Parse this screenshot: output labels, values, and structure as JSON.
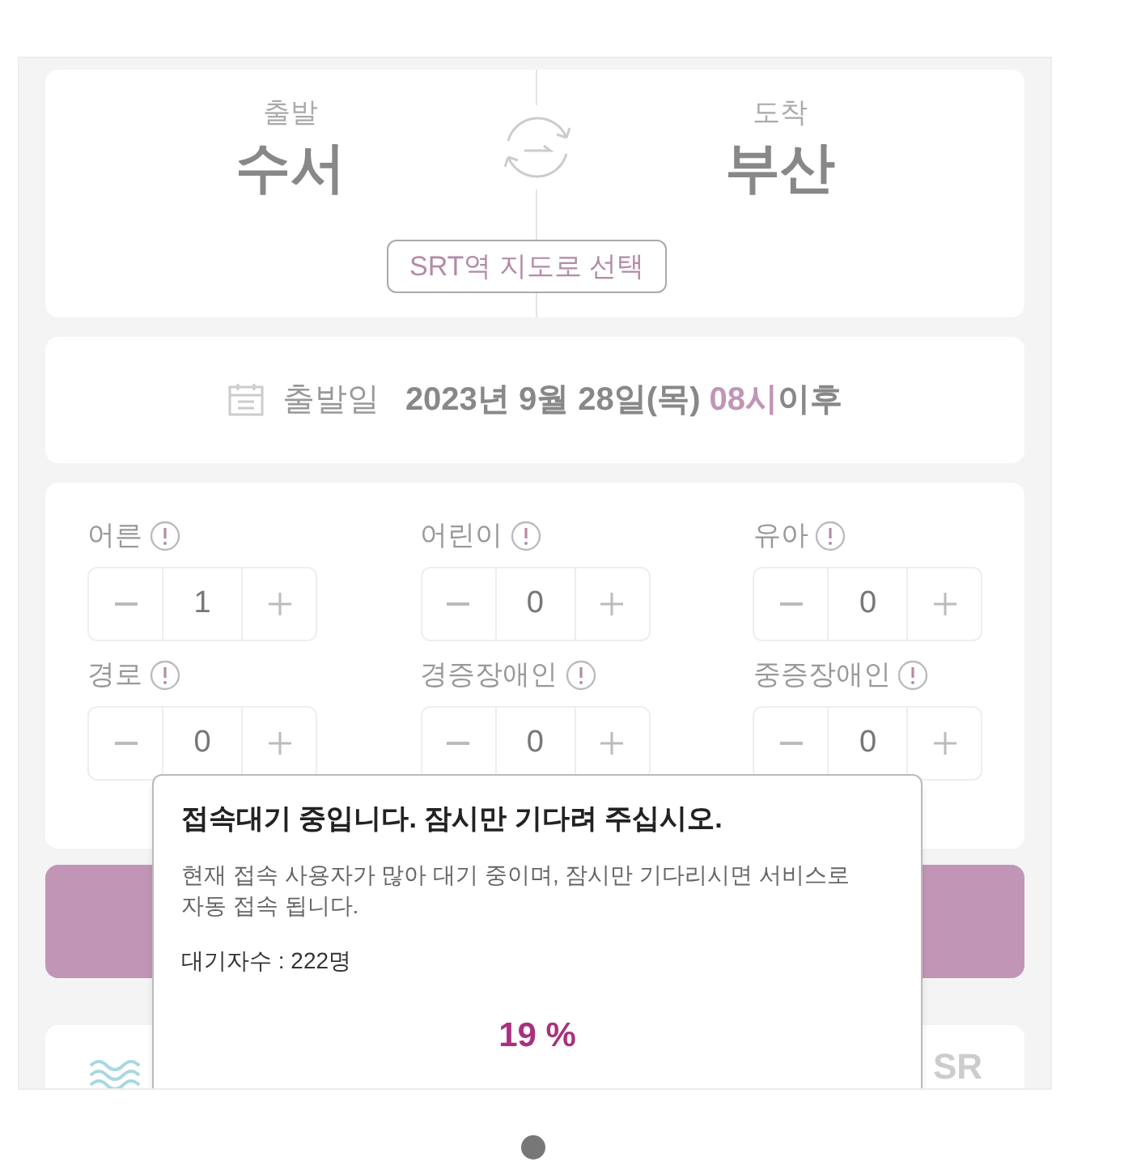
{
  "route": {
    "departure_label": "출발",
    "departure": "수서",
    "arrival_label": "도착",
    "arrival": "부산",
    "map_button": "SRT역 지도로 선택"
  },
  "date": {
    "label": "출발일",
    "value": "2023년 9월 28일(목)",
    "hour": "08시",
    "suffix": "이후"
  },
  "passengers": [
    {
      "label": "어른",
      "count": "1"
    },
    {
      "label": "어린이",
      "count": "0"
    },
    {
      "label": "유아",
      "count": "0"
    },
    {
      "label": "경로",
      "count": "0"
    },
    {
      "label": "경증장애인",
      "count": "0"
    },
    {
      "label": "중증장애인",
      "count": "0"
    }
  ],
  "footer_logo": "SR",
  "dialog": {
    "title": "접속대기 중입니다. 잠시만 기다려 주십시오.",
    "message": "현재 접속 사용자가 많아 대기 중이며, 잠시만 기다리시면 서비스로 자동 접속 됩니다.",
    "queue": "대기자수 : 222명",
    "percent": "19 %"
  }
}
